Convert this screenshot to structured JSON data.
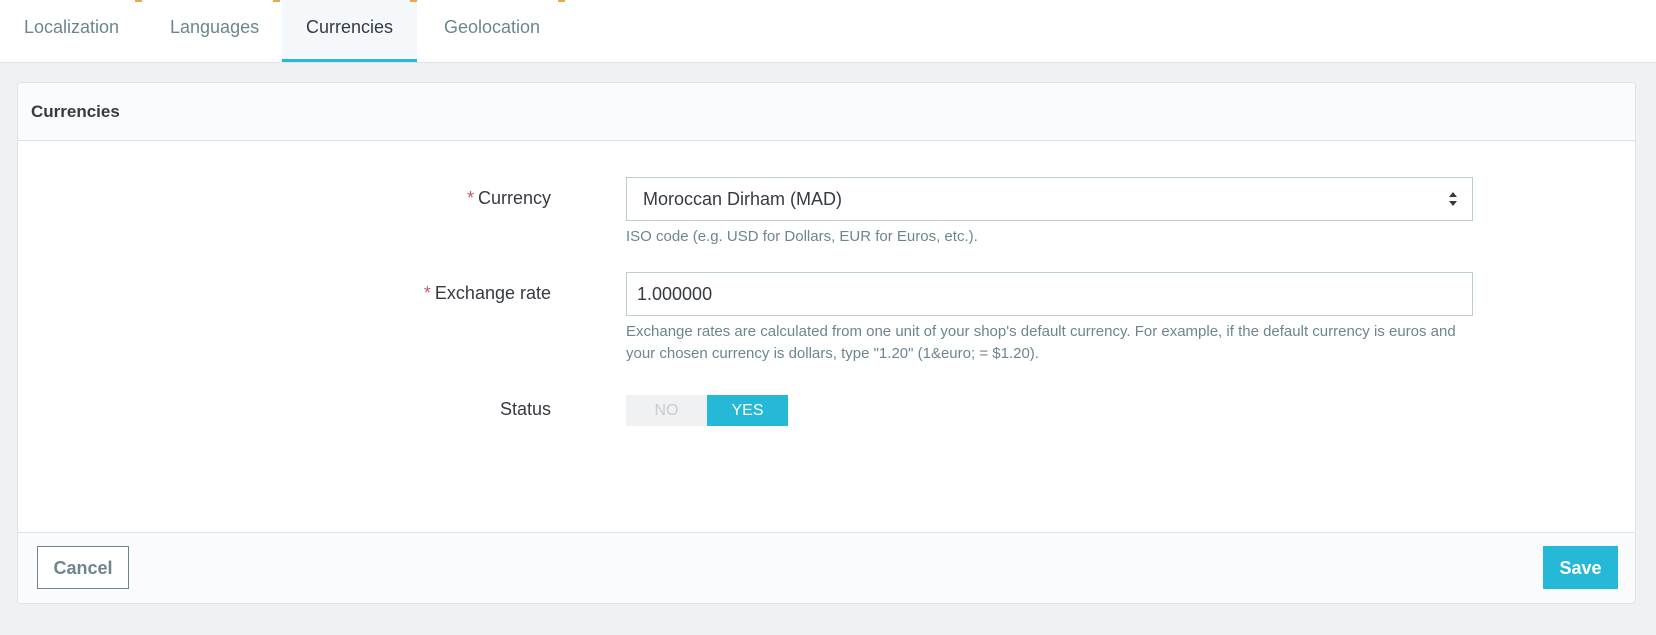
{
  "tabs": [
    {
      "label": "Localization",
      "active": false
    },
    {
      "label": "Languages",
      "active": false
    },
    {
      "label": "Currencies",
      "active": true
    },
    {
      "label": "Geolocation",
      "active": false
    }
  ],
  "panel": {
    "title": "Currencies"
  },
  "form": {
    "required_marker": "*",
    "currency": {
      "label": "Currency",
      "selected": "Moroccan Dirham (MAD)",
      "help": "ISO code (e.g. USD for Dollars, EUR for Euros, etc.)."
    },
    "exchange_rate": {
      "label": "Exchange rate",
      "value": "1.000000",
      "help": "Exchange rates are calculated from one unit of your shop's default currency. For example, if the default currency is euros and your chosen currency is dollars, type \"1.20\" (1&euro; = $1.20)."
    },
    "status": {
      "label": "Status",
      "no_label": "NO",
      "yes_label": "YES",
      "value": "YES"
    }
  },
  "footer": {
    "cancel_label": "Cancel",
    "save_label": "Save"
  },
  "colors": {
    "accent": "#25b9d7",
    "required": "#c05c67",
    "page_background": "#eff1f2",
    "tab_marker": "#f0a44a"
  },
  "icons": {
    "select_arrows": "sort-arrows-icon"
  }
}
